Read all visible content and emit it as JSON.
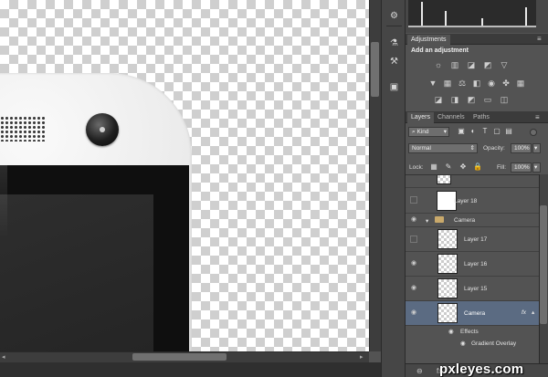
{
  "adjustments": {
    "tab_label": "Adjustments",
    "heading": "Add an adjustment",
    "row1_icons": [
      "brightness-contrast-icon",
      "levels-icon",
      "curves-icon",
      "exposure-icon",
      "panel-menu-icon"
    ],
    "row2_icons": [
      "vibrance-icon",
      "hue-saturation-icon",
      "color-balance-icon",
      "black-white-icon",
      "photo-filter-icon",
      "channel-mixer-icon",
      "color-lookup-icon"
    ],
    "row3_icons": [
      "invert-icon",
      "posterize-icon",
      "threshold-icon",
      "gradient-map-icon",
      "selective-color-icon"
    ]
  },
  "layers_panel": {
    "tabs": [
      "Layers",
      "Channels",
      "Paths"
    ],
    "filter_value": "Kind",
    "blend_mode": "Normal",
    "opacity_label": "Opacity:",
    "opacity_value": "100%",
    "lock_label": "Lock:",
    "fill_label": "Fill:",
    "fill_value": "100%",
    "layers": {
      "layer18": "Layer 18",
      "camera_group": "Camera",
      "layer17": "Layer 17",
      "layer16": "Layer 16",
      "layer15": "Layer 15",
      "camera_layer": "Camera",
      "effects": "Effects",
      "gradient_overlay": "Gradient Overlay",
      "fx_badge": "fx"
    }
  },
  "watermark": "pxleyes.com",
  "colors": {
    "selected_layer": "#5b6b82",
    "panel_bg": "#535353",
    "canvas_checker": "#cfcfcf"
  }
}
